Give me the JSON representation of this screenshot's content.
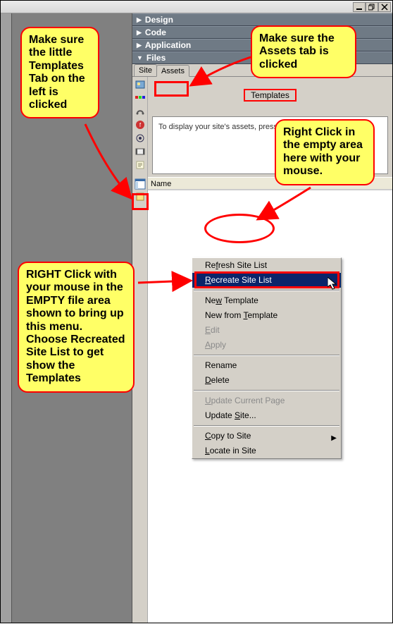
{
  "window": {
    "min": "_",
    "max": "❐",
    "close": "×"
  },
  "panels": {
    "design": "Design",
    "code": "Code",
    "application": "Application",
    "files": "Files"
  },
  "tabs": {
    "site": "Site",
    "assets": "Assets"
  },
  "templates_heading": "Templates",
  "preview_text": "To display your site's assets, press",
  "list_header_name": "Name",
  "context_menu": {
    "refresh": "Refresh Site List",
    "recreate": "Recreate Site List",
    "new_template": "New Template",
    "new_from_template": "New from Template",
    "edit": "Edit",
    "apply": "Apply",
    "rename": "Rename",
    "delete": "Delete",
    "update_current": "Update Current Page",
    "update_site": "Update Site...",
    "copy_to_site": "Copy to Site",
    "locate": "Locate in Site"
  },
  "annotations": {
    "a1": "Make sure the little Templates Tab on the left is clicked",
    "a2": "Make sure the Assets tab is clicked",
    "a3": "Right Click in the empty area here with your mouse.",
    "a4": "RIGHT Click with your mouse in the EMPTY file area shown to bring up this menu. Choose Recreated Site List to get show the Templates"
  }
}
